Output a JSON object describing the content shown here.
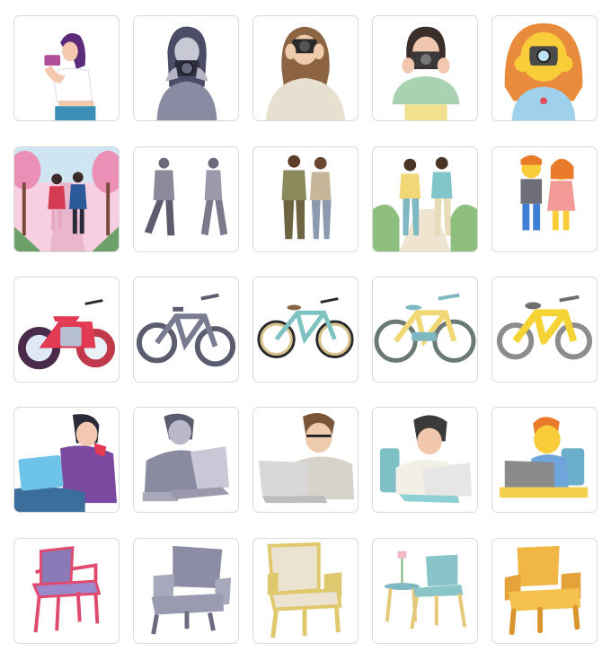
{
  "grid": {
    "rows": [
      {
        "subject": "person-with-camera",
        "styles": [
          "flat-illustration",
          "halftone-monochrome",
          "realistic-3d",
          "pastel-3d",
          "emoji-3d"
        ]
      },
      {
        "subject": "couple-walking",
        "styles": [
          "flat-illustration",
          "halftone-monochrome",
          "realistic-3d",
          "pastel-3d",
          "emoji-3d"
        ]
      },
      {
        "subject": "bike",
        "styles": [
          "flat-illustration",
          "halftone-monochrome",
          "realistic-3d",
          "pastel-3d",
          "emoji-3d"
        ]
      },
      {
        "subject": "person-on-laptop",
        "styles": [
          "flat-illustration",
          "halftone-monochrome",
          "realistic-3d",
          "pastel-3d",
          "emoji-3d"
        ]
      },
      {
        "subject": "chair",
        "styles": [
          "flat-illustration",
          "halftone-monochrome",
          "realistic-3d",
          "pastel-3d",
          "emoji-3d"
        ]
      }
    ]
  }
}
